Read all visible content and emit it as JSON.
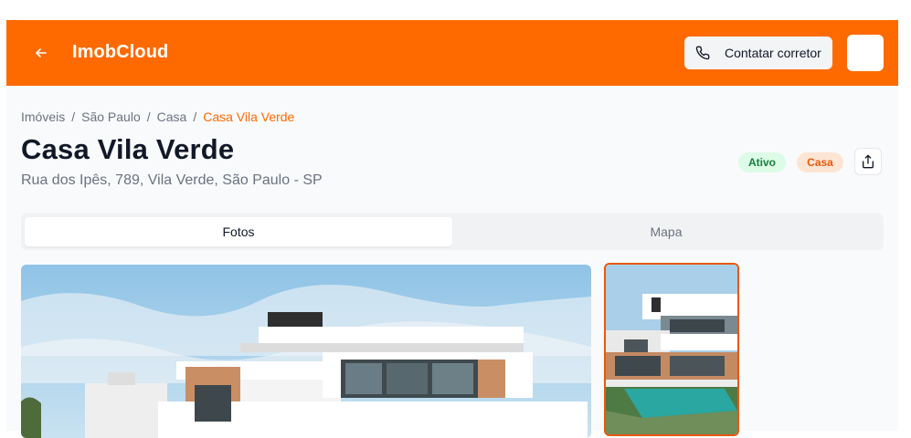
{
  "header": {
    "back_icon": "arrow-left-icon",
    "brand": "ImobCloud",
    "contact_label": "Contatar corretor",
    "contact_icon": "phone-icon",
    "color": "#ff6a00"
  },
  "breadcrumb": {
    "items": [
      "Imóveis",
      "São Paulo",
      "Casa"
    ],
    "current": "Casa Vila Verde",
    "separator": "/"
  },
  "property": {
    "title": "Casa Vila Verde",
    "address": "Rua dos Ipês, 789, Vila Verde, São Paulo - SP",
    "status_badge": "Ativo",
    "type_badge": "Casa",
    "share_icon": "share-icon"
  },
  "tabs": [
    {
      "label": "Fotos",
      "active": true
    },
    {
      "label": "Mapa",
      "active": false
    }
  ],
  "gallery": {
    "selected_index": 0,
    "photos": [
      "main-photo",
      "thumbnail-1"
    ]
  }
}
